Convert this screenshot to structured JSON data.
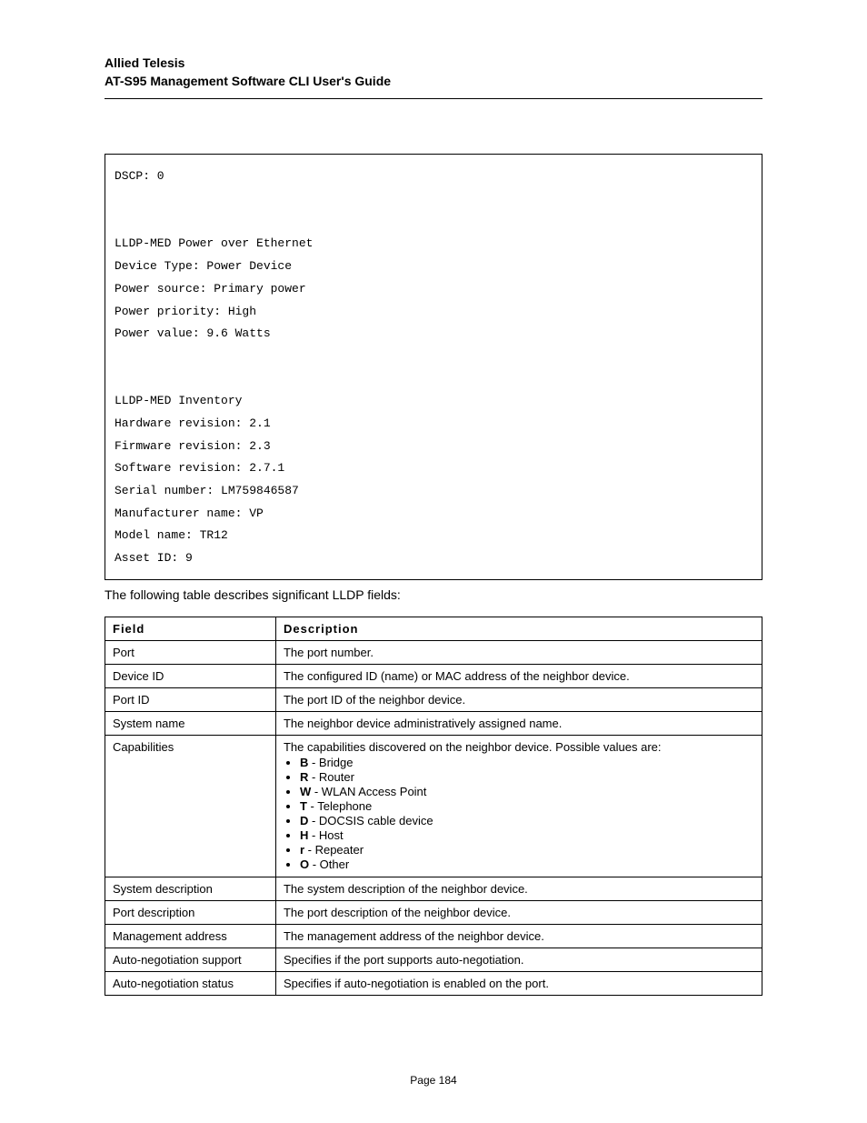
{
  "header": {
    "line1": "Allied Telesis",
    "line2": "AT-S95 Management Software CLI User's Guide"
  },
  "code": {
    "dscp": "DSCP: 0",
    "poe_title": "LLDP-MED Power over Ethernet",
    "device_type": "Device Type: Power Device",
    "power_source": "Power source: Primary power",
    "power_priority": "Power priority: High",
    "power_value": "Power value: 9.6 Watts",
    "inv_title": "LLDP-MED Inventory",
    "hw_rev": "Hardware revision: 2.1",
    "fw_rev": "Firmware revision: 2.3",
    "sw_rev": "Software revision: 2.7.1",
    "serial": "Serial number: LM759846587",
    "manufacturer": "Manufacturer name: VP",
    "model": "Model name: TR12",
    "asset": "Asset ID: 9"
  },
  "intro": "The following table describes significant LLDP fields:",
  "table": {
    "head_field": "Field",
    "head_desc": "Description",
    "rows": [
      {
        "field": "Port",
        "desc": "The port number."
      },
      {
        "field": "Device ID",
        "desc": "The configured ID (name) or MAC address of the neighbor device."
      },
      {
        "field": "Port ID",
        "desc": "The port ID of the neighbor device."
      },
      {
        "field": "System name",
        "desc": "The neighbor device administratively assigned name."
      },
      {
        "field": "Capabilities",
        "desc_intro": "The capabilities discovered on the neighbor device. Possible values are:",
        "caps": [
          {
            "b": "B",
            "t": " - Bridge"
          },
          {
            "b": "R",
            "t": " - Router"
          },
          {
            "b": "W",
            "t": " - WLAN Access Point"
          },
          {
            "b": "T",
            "t": " - Telephone"
          },
          {
            "b": "D",
            "t": " - DOCSIS cable device"
          },
          {
            "b": "H",
            "t": " - Host"
          },
          {
            "b": "r",
            "t": " - Repeater"
          },
          {
            "b": "O",
            "t": " - Other"
          }
        ]
      },
      {
        "field": "System description",
        "desc": "The system description of the neighbor device."
      },
      {
        "field": "Port description",
        "desc": "The port description of the neighbor device."
      },
      {
        "field": "Management address",
        "desc": "The management address of the neighbor device."
      },
      {
        "field": "Auto-negotiation support",
        "desc": "Specifies if the port supports auto-negotiation."
      },
      {
        "field": "Auto-negotiation status",
        "desc": "Specifies if auto-negotiation is enabled on the port."
      }
    ]
  },
  "footer": "Page 184"
}
